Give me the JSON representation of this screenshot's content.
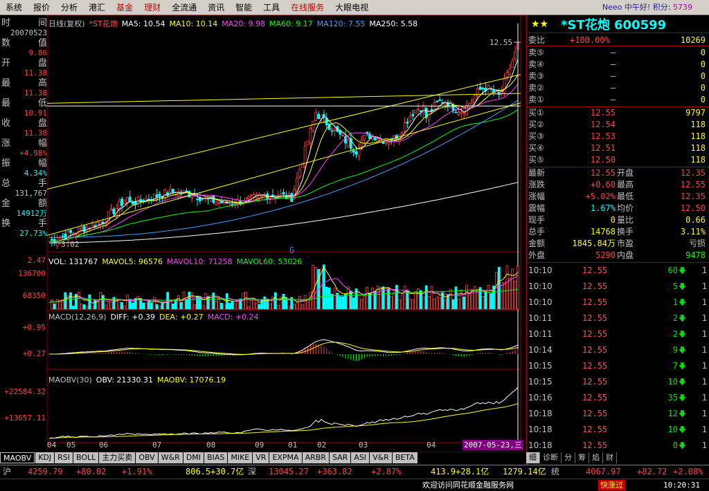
{
  "menu": [
    "系统",
    "报价",
    "分析",
    "港汇",
    "基金",
    "理财",
    "全流通",
    "资讯",
    "智能",
    "工具",
    "在线服务",
    "大眼电视"
  ],
  "menu_red": [
    4,
    5,
    10
  ],
  "greeting": "Neeo 中午好! 积分: ",
  "points": "5739",
  "left_info": [
    {
      "label": "时间",
      "value": "20070523",
      "color": "#c0c0c0"
    },
    {
      "label": "数值",
      "value": "9.86",
      "color": "#ff4040"
    },
    {
      "label": "开盘",
      "value": "11.38",
      "color": "#ff4040"
    },
    {
      "label": "最高",
      "value": "11.38",
      "color": "#ff4040"
    },
    {
      "label": "最低",
      "value": "10.91",
      "color": "#ff4040"
    },
    {
      "label": "收盘",
      "value": "11.38",
      "color": "#ff4040"
    },
    {
      "label": "涨幅",
      "value": "+4.98%",
      "color": "#ff4040"
    },
    {
      "label": "振幅",
      "value": "4.34%",
      "color": "#00ffff"
    },
    {
      "label": "总手",
      "value": "131,767",
      "color": "#c0c0c0"
    },
    {
      "label": "金额",
      "value": "14912万",
      "color": "#00ffff"
    },
    {
      "label": "换手",
      "value": "27.73%",
      "color": "#00ffff"
    }
  ],
  "chart": {
    "header_kline": "日线(复权)",
    "stock": "*ST花炮",
    "ma_legend": [
      {
        "text": "MA5: 10.54",
        "color": "#ffffff"
      },
      {
        "text": "MA10: 10.14",
        "color": "#ffff00"
      },
      {
        "text": "MA20: 9.98",
        "color": "#ff40ff"
      },
      {
        "text": "MA60: 9.17",
        "color": "#00ff00"
      },
      {
        "text": "MA120: 7.55",
        "color": "#40a0ff"
      },
      {
        "text": "MA250: 5.58",
        "color": "#ffffff"
      }
    ],
    "vol_legend": [
      {
        "text": "VOL: 131767",
        "color": "#ffffff"
      },
      {
        "text": "MAVOL5: 96576",
        "color": "#ffff00"
      },
      {
        "text": "MAVOL10: 71258",
        "color": "#ff40ff"
      },
      {
        "text": "MAVOL60: 53026",
        "color": "#00ff00"
      }
    ],
    "macd_legend": [
      {
        "text": "MACD(12,26,9)",
        "color": "#c0c0c0"
      },
      {
        "text": "DIFF: +0.39",
        "color": "#ffffff"
      },
      {
        "text": "DEA: +0.27",
        "color": "#ffff00"
      },
      {
        "text": "MACD: +0.24",
        "color": "#ff40ff"
      }
    ],
    "obv_legend": [
      {
        "text": "MAOBV(30)",
        "color": "#c0c0c0"
      },
      {
        "text": "OBV: 21330.31",
        "color": "#ffffff"
      },
      {
        "text": "MAOBV: 17076.19",
        "color": "#ffff00"
      }
    ],
    "high_label": "12.55",
    "low_label": "3.02",
    "g_label": "G",
    "axis_labels": {
      "vol_top": "2.47",
      "vol_1": "136700",
      "vol_2": "68350",
      "macd_1": "+0.95",
      "macd_2": "+0.27",
      "obv_1": "+22584.32",
      "obv_2": "+13657.11"
    },
    "months": [
      "04",
      "05",
      "06",
      "07",
      "08",
      "09",
      "01",
      "02",
      "03",
      "04"
    ],
    "date_label": "2007-05-23,三"
  },
  "chart_data": {
    "type": "candlestick",
    "price_range": [
      3.02,
      12.55
    ],
    "volume_axis": [
      68350,
      136700
    ],
    "macd_axis": [
      0.27,
      0.95
    ],
    "obv_axis": [
      13657.11,
      22584.32
    ]
  },
  "quote": {
    "stars": "★★",
    "name": "*ST花炮 600599",
    "weibi_label": "委比",
    "weibi_pct": "+100.00%",
    "weibi_val": "10269",
    "asks": [
      {
        "label": "卖⑤",
        "price": "–",
        "vol": "0"
      },
      {
        "label": "卖④",
        "price": "–",
        "vol": "0"
      },
      {
        "label": "卖③",
        "price": "–",
        "vol": "0"
      },
      {
        "label": "卖②",
        "price": "–",
        "vol": "0"
      },
      {
        "label": "卖①",
        "price": "–",
        "vol": "0"
      }
    ],
    "bids": [
      {
        "label": "买①",
        "price": "12.55",
        "vol": "9797"
      },
      {
        "label": "买②",
        "price": "12.54",
        "vol": "118"
      },
      {
        "label": "买③",
        "price": "12.53",
        "vol": "118"
      },
      {
        "label": "买④",
        "price": "12.51",
        "vol": "118"
      },
      {
        "label": "买⑤",
        "price": "12.50",
        "vol": "118"
      }
    ],
    "stats": [
      {
        "l1": "最新",
        "v1": "12.55",
        "c1": "#ff4040",
        "l2": "开盘",
        "v2": "12.35",
        "c2": "#ff4040"
      },
      {
        "l1": "涨跌",
        "v1": "+0.60",
        "c1": "#ff4040",
        "l2": "最高",
        "v2": "12.55",
        "c2": "#ff4040"
      },
      {
        "l1": "涨幅",
        "v1": "+5.02%",
        "c1": "#ff4040",
        "l2": "最低",
        "v2": "12.35",
        "c2": "#ff4040"
      },
      {
        "l1": "震幅",
        "v1": "1.67%",
        "c1": "#00ffff",
        "l2": "均价",
        "v2": "12.50",
        "c2": "#ff4040"
      },
      {
        "l1": "现手",
        "v1": "0",
        "c1": "#ffff00",
        "l2": "量比",
        "v2": "0.66",
        "c2": "#ffff00"
      },
      {
        "l1": "总手",
        "v1": "14768",
        "c1": "#ffff00",
        "l2": "换手",
        "v2": "3.11%",
        "c2": "#ffff00"
      },
      {
        "l1": "金额",
        "v1": "1845.84万",
        "c1": "#ffff00",
        "l2": "市盈",
        "v2": "亏损",
        "c2": "#c0c0c0"
      },
      {
        "l1": "外盘",
        "v1": "5290",
        "c1": "#ff4040",
        "l2": "内盘",
        "v2": "9478",
        "c2": "#00ff00"
      }
    ],
    "ticks": [
      {
        "time": "10:10",
        "price": "12.55",
        "vol": "60",
        "cnt": "1"
      },
      {
        "time": "10:10",
        "price": "12.55",
        "vol": "5",
        "cnt": "1"
      },
      {
        "time": "10:10",
        "price": "12.55",
        "vol": "1",
        "cnt": "1"
      },
      {
        "time": "10:11",
        "price": "12.55",
        "vol": "2",
        "cnt": "1"
      },
      {
        "time": "10:11",
        "price": "12.55",
        "vol": "2",
        "cnt": "1"
      },
      {
        "time": "10:14",
        "price": "12.55",
        "vol": "9",
        "cnt": "1"
      },
      {
        "time": "10:15",
        "price": "12.55",
        "vol": "7",
        "cnt": "1"
      },
      {
        "time": "10:15",
        "price": "12.55",
        "vol": "10",
        "cnt": "1"
      },
      {
        "time": "10:16",
        "price": "12.55",
        "vol": "35",
        "cnt": "1"
      },
      {
        "time": "10:18",
        "price": "12.55",
        "vol": "12",
        "cnt": "1"
      },
      {
        "time": "10:18",
        "price": "12.55",
        "vol": "10",
        "cnt": "1"
      },
      {
        "time": "10:18",
        "price": "12.55",
        "vol": "0",
        "cnt": "1"
      }
    ],
    "arrow": "🡇",
    "tabs": [
      "细",
      "诊断",
      "分",
      "筹",
      "焰",
      "财"
    ]
  },
  "ind_tabs": [
    "MAOBV",
    "KDJ",
    "RSI",
    "BOLL",
    "主力买卖",
    "OBV",
    "W&R",
    "DMI",
    "BIAS",
    "MIKE",
    "VR",
    "EXPMA",
    "ARBR",
    "SAR",
    "ASI",
    "V&R",
    "BETA"
  ],
  "status": {
    "sh_label": "沪",
    "sh_idx": "4259.79",
    "sh_chg": "+80.02",
    "sh_pct": "+1.91%",
    "sh_amt": "806.5+30.7亿",
    "sz_label": "深",
    "sz_idx": "13045.27",
    "sz_chg": "+363.82",
    "sz_pct": "+2.87%",
    "sz_amt": "413.9+28.1亿",
    "t_label": "统",
    "t_idx": "1279.14亿",
    "t_val": "4067.97",
    "t_chg": "+82.72",
    "t_pct": "+2.08%",
    "welcome": "欢迎访问同花顺金融服务网",
    "fast": "快涨过",
    "clock": "10:20:31"
  }
}
